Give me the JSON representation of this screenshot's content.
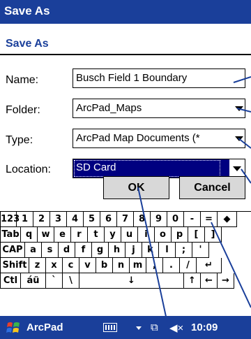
{
  "window": {
    "title": "Save As"
  },
  "dialog": {
    "heading": "Save As",
    "name_label": "Name:",
    "name_value": "Busch Field 1 Boundary",
    "folder_label": "Folder:",
    "folder_value": "ArcPad_Maps",
    "type_label": "Type:",
    "type_value": "ArcPad Map Documents (*",
    "location_label": "Location:",
    "location_value": "SD Card",
    "ok_label": "OK",
    "cancel_label": "Cancel"
  },
  "keyboard": {
    "row1": [
      "123",
      "1",
      "2",
      "3",
      "4",
      "5",
      "6",
      "7",
      "8",
      "9",
      "0",
      "-",
      "=",
      "◆"
    ],
    "row2": [
      "Tab",
      "q",
      "w",
      "e",
      "r",
      "t",
      "y",
      "u",
      "i",
      "o",
      "p",
      "[",
      "]"
    ],
    "row3": [
      "CAP",
      "a",
      "s",
      "d",
      "f",
      "g",
      "h",
      "j",
      "k",
      "l",
      ";",
      "'"
    ],
    "row4": [
      "Shift",
      "z",
      "x",
      "c",
      "v",
      "b",
      "n",
      "m",
      ",",
      ".",
      "/",
      "↵"
    ],
    "row5": [
      "Ctl",
      "áü",
      "`",
      "\\",
      "↓",
      "↑",
      "←",
      "→"
    ]
  },
  "taskbar": {
    "app_name": "ArcPad",
    "net_icon": "⧉",
    "volume_icon": "◀×",
    "time": "10:09"
  },
  "colors": {
    "titlebar": "#1a3f9a",
    "selection": "#000080"
  }
}
